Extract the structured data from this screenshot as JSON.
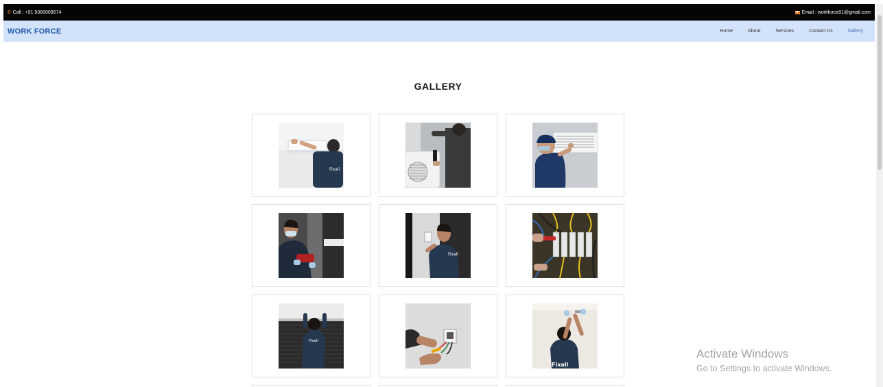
{
  "topbar": {
    "call": "Call : +91 9360009574",
    "email": "Email : workforce01@gmail.com"
  },
  "navbar": {
    "brand": "WORK FORCE",
    "links": [
      "Home",
      "About",
      "Services",
      "Contact Us",
      "Gallery"
    ],
    "active": "Gallery"
  },
  "page_title": "GALLERY",
  "gallery": {
    "images": [
      {
        "name": "ac-indoor-unit-technician",
        "icon": "photo-icon"
      },
      {
        "name": "outdoor-ac-unit-repair",
        "icon": "photo-icon"
      },
      {
        "name": "ac-filter-service",
        "icon": "photo-icon"
      },
      {
        "name": "drilling-technician",
        "icon": "photo-icon"
      },
      {
        "name": "wall-switch-repair",
        "icon": "photo-icon"
      },
      {
        "name": "electrical-panel-wiring",
        "icon": "photo-icon"
      },
      {
        "name": "window-blind-install",
        "icon": "photo-icon"
      },
      {
        "name": "socket-wiring",
        "icon": "photo-icon"
      },
      {
        "name": "ceiling-light-install",
        "icon": "photo-icon"
      }
    ],
    "shirt_logo": "Fixall"
  },
  "watermark": {
    "line1": "Activate Windows",
    "line2": "Go to Settings to activate Windows."
  },
  "colors": {
    "topbar": "#050505",
    "navbar": "#d2e2fa",
    "brand": "#1e56a8",
    "accent": "#e0782c"
  }
}
